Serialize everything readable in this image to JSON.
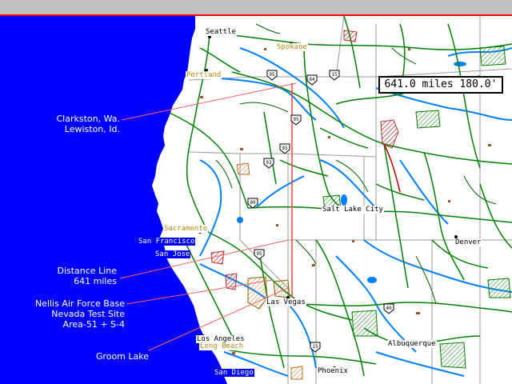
{
  "distance_readout": "641.0 miles 180.0'",
  "cities": [
    {
      "id": "seattle",
      "name": "Seattle",
      "style": "black"
    },
    {
      "id": "spokane",
      "name": "Spokane",
      "style": "orange"
    },
    {
      "id": "portland",
      "name": "Portland",
      "style": "orange"
    },
    {
      "id": "salt-lake-city",
      "name": "Salt Lake City",
      "style": "black"
    },
    {
      "id": "sacramento",
      "name": "Sacramento",
      "style": "orange"
    },
    {
      "id": "san-francisco",
      "name": "San Francisco",
      "style": "white"
    },
    {
      "id": "san-jose",
      "name": "San Jose",
      "style": "white"
    },
    {
      "id": "denver",
      "name": "Denver",
      "style": "black"
    },
    {
      "id": "las-vegas",
      "name": "Las Vegas",
      "style": "black"
    },
    {
      "id": "los-angeles",
      "name": "Los Angeles",
      "style": "black"
    },
    {
      "id": "long-beach",
      "name": "Long Beach",
      "style": "orange"
    },
    {
      "id": "san-diego",
      "name": "San Diego",
      "style": "white"
    },
    {
      "id": "albuquerque",
      "name": "Albuquerque",
      "style": "black"
    },
    {
      "id": "phoenix",
      "name": "Phoenix",
      "style": "black"
    }
  ],
  "annotations": {
    "clarkston": {
      "line1": "Clarkston, Wa.",
      "line2": "Lewiston, Id."
    },
    "distance": {
      "line1": "Distance Line",
      "line2": "641 miles"
    },
    "nellis": {
      "line1": "Nellis Air Force Base",
      "line2": "Nevada Test Site",
      "line3": "Area-51 + S-4"
    },
    "groom": {
      "line1": "Groom Lake"
    }
  },
  "highway_shields": [
    "95",
    "15",
    "84",
    "95",
    "95",
    "93",
    "80",
    "95",
    "15",
    "40"
  ],
  "colors": {
    "ocean": "#0000ff",
    "land": "#ffffff",
    "roads": "#008000",
    "rivers": "#0080ff",
    "annotation_lines": "#ff6060",
    "top_bar": "#c0c0c0",
    "top_bar_line": "#ff0000"
  }
}
